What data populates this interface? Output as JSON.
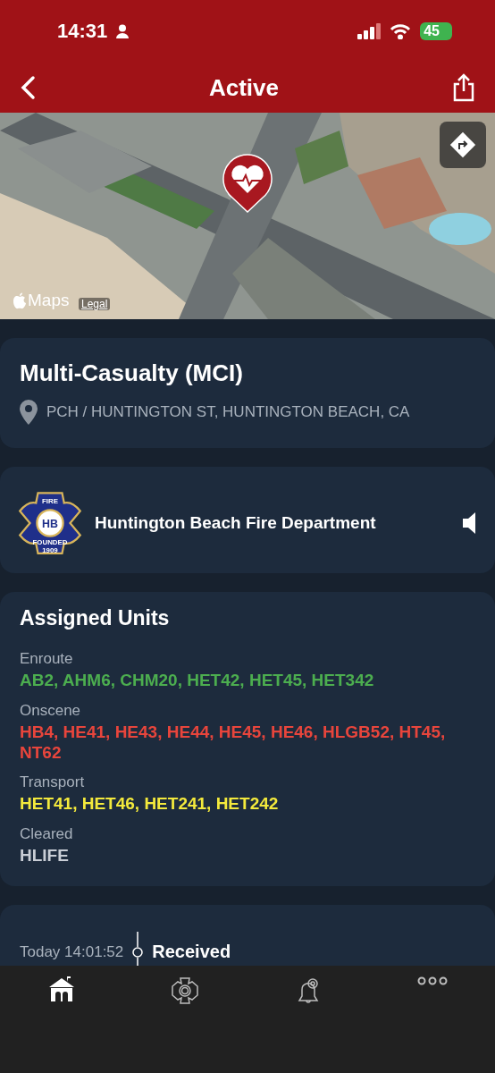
{
  "status_bar": {
    "time": "14:31",
    "battery": "45"
  },
  "nav": {
    "title": "Active"
  },
  "map": {
    "kind": "picture",
    "brand": "Maps",
    "legal": "Legal"
  },
  "incident": {
    "title": "Multi-Casualty (MCI)",
    "address": "PCH / HUNTINGTON ST, HUNTINGTON BEACH, CA"
  },
  "agency": {
    "name": "Huntington Beach Fire Department",
    "logo": {
      "top": "FIRE",
      "center": "HB",
      "bottom": "FOUNDED",
      "year": "1909"
    },
    "sound_on": true
  },
  "units": {
    "title": "Assigned Units",
    "groups": [
      {
        "status": "Enroute",
        "color": "#4cae4f",
        "units": "AB2, AHM6, CHM20, HET42, HET45, HET342"
      },
      {
        "status": "Onscene",
        "color": "#e8453c",
        "units": "HB4, HE41, HE43, HE44, HE45, HE46, HLGB52, HT45, NT62"
      },
      {
        "status": "Transport",
        "color": "#f3e93c",
        "units": "HET41, HET46, HET241, HET242"
      },
      {
        "status": "Cleared",
        "color": "#c9ced6",
        "units": "HLIFE"
      }
    ]
  },
  "timeline": [
    {
      "time": "Today 14:01:52",
      "event": "Received"
    }
  ],
  "tab_bar": [
    {
      "kind": "home",
      "selected": true
    },
    {
      "kind": "department",
      "selected": false
    },
    {
      "kind": "alerts",
      "selected": false
    },
    {
      "kind": "more",
      "selected": false
    }
  ]
}
